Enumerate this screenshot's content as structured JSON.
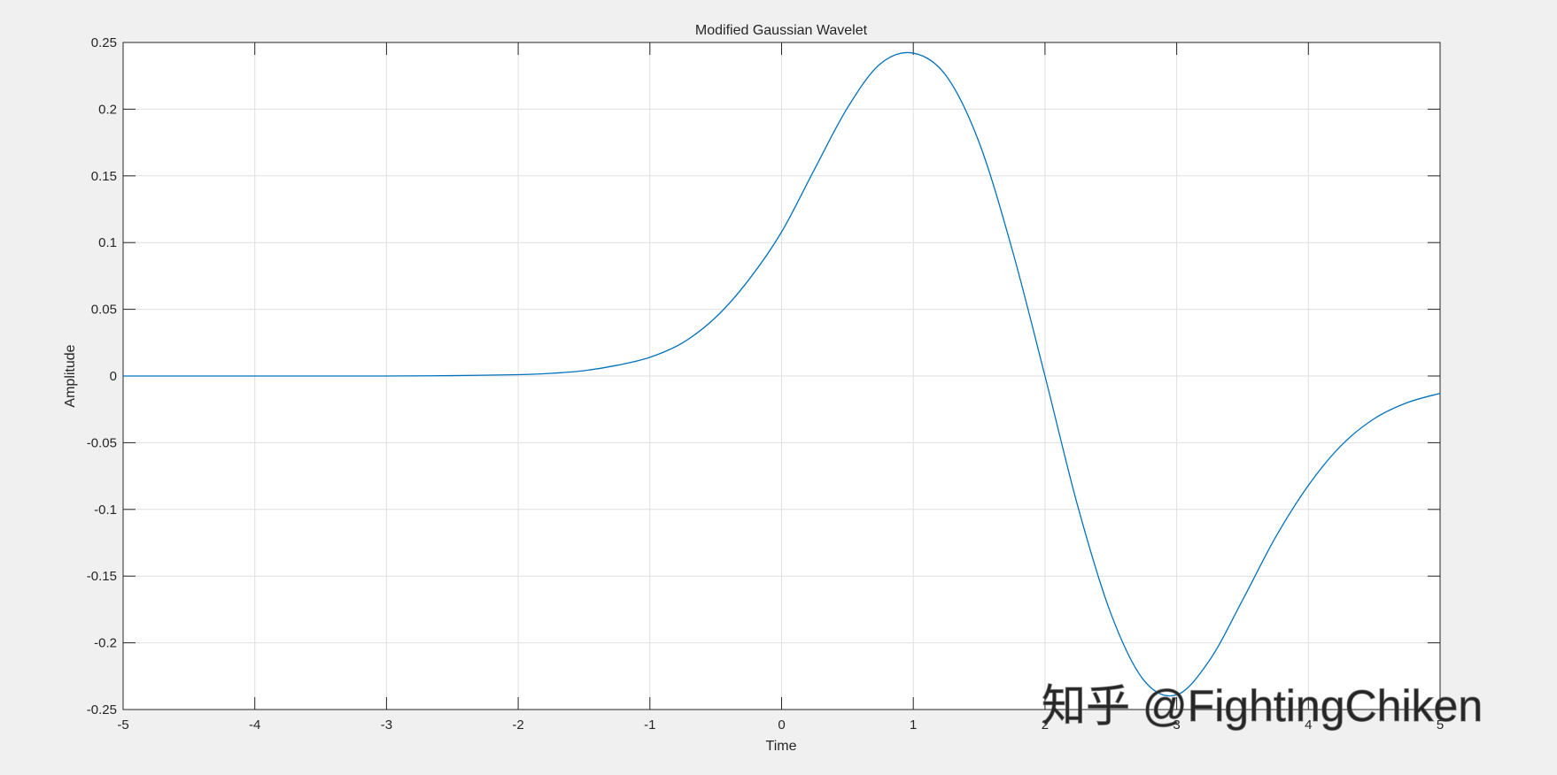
{
  "chart_data": {
    "type": "line",
    "title": "Modified Gaussian Wavelet",
    "xlabel": "Time",
    "ylabel": "Amplitude",
    "xlim": [
      -5,
      5
    ],
    "ylim": [
      -0.25,
      0.25
    ],
    "xticks": [
      -5,
      -4,
      -3,
      -2,
      -1,
      0,
      1,
      2,
      3,
      4,
      5
    ],
    "yticks": [
      0.25,
      0.2,
      0.15,
      0.1,
      0.05,
      0,
      -0.05,
      -0.1,
      -0.15,
      -0.2,
      -0.25
    ],
    "xtick_labels": [
      "-5",
      "-4",
      "-3",
      "-2",
      "-1",
      "0",
      "1",
      "2",
      "3",
      "4",
      "5"
    ],
    "ytick_labels": [
      "0.25",
      "0.2",
      "0.15",
      "0.1",
      "0.05",
      "0",
      "-0.05",
      "-0.1",
      "-0.15",
      "-0.2",
      "-0.25"
    ],
    "grid": true,
    "line_color": "#0072bd",
    "series": [
      {
        "x": [
          -5,
          -4,
          -3,
          -2.5,
          -2,
          -1.75,
          -1.5,
          -1.25,
          -1,
          -0.75,
          -0.5,
          -0.25,
          0,
          0.25,
          0.5,
          0.75,
          1,
          1.25,
          1.5,
          1.75,
          2,
          2.25,
          2.5,
          2.75,
          3,
          3.25,
          3.5,
          3.75,
          4,
          4.25,
          4.5,
          4.75,
          5
        ],
        "y": [
          0,
          0,
          0,
          0.0003,
          0.001,
          0.002,
          0.004,
          0.008,
          0.014,
          0.025,
          0.044,
          0.072,
          0.108,
          0.155,
          0.201,
          0.234,
          0.242,
          0.225,
          0.175,
          0.095,
          0.0,
          -0.098,
          -0.178,
          -0.228,
          -0.239,
          -0.213,
          -0.168,
          -0.121,
          -0.082,
          -0.052,
          -0.032,
          -0.02,
          -0.013
        ]
      }
    ]
  },
  "watermark": {
    "text": "知乎 @FightingChiken"
  }
}
